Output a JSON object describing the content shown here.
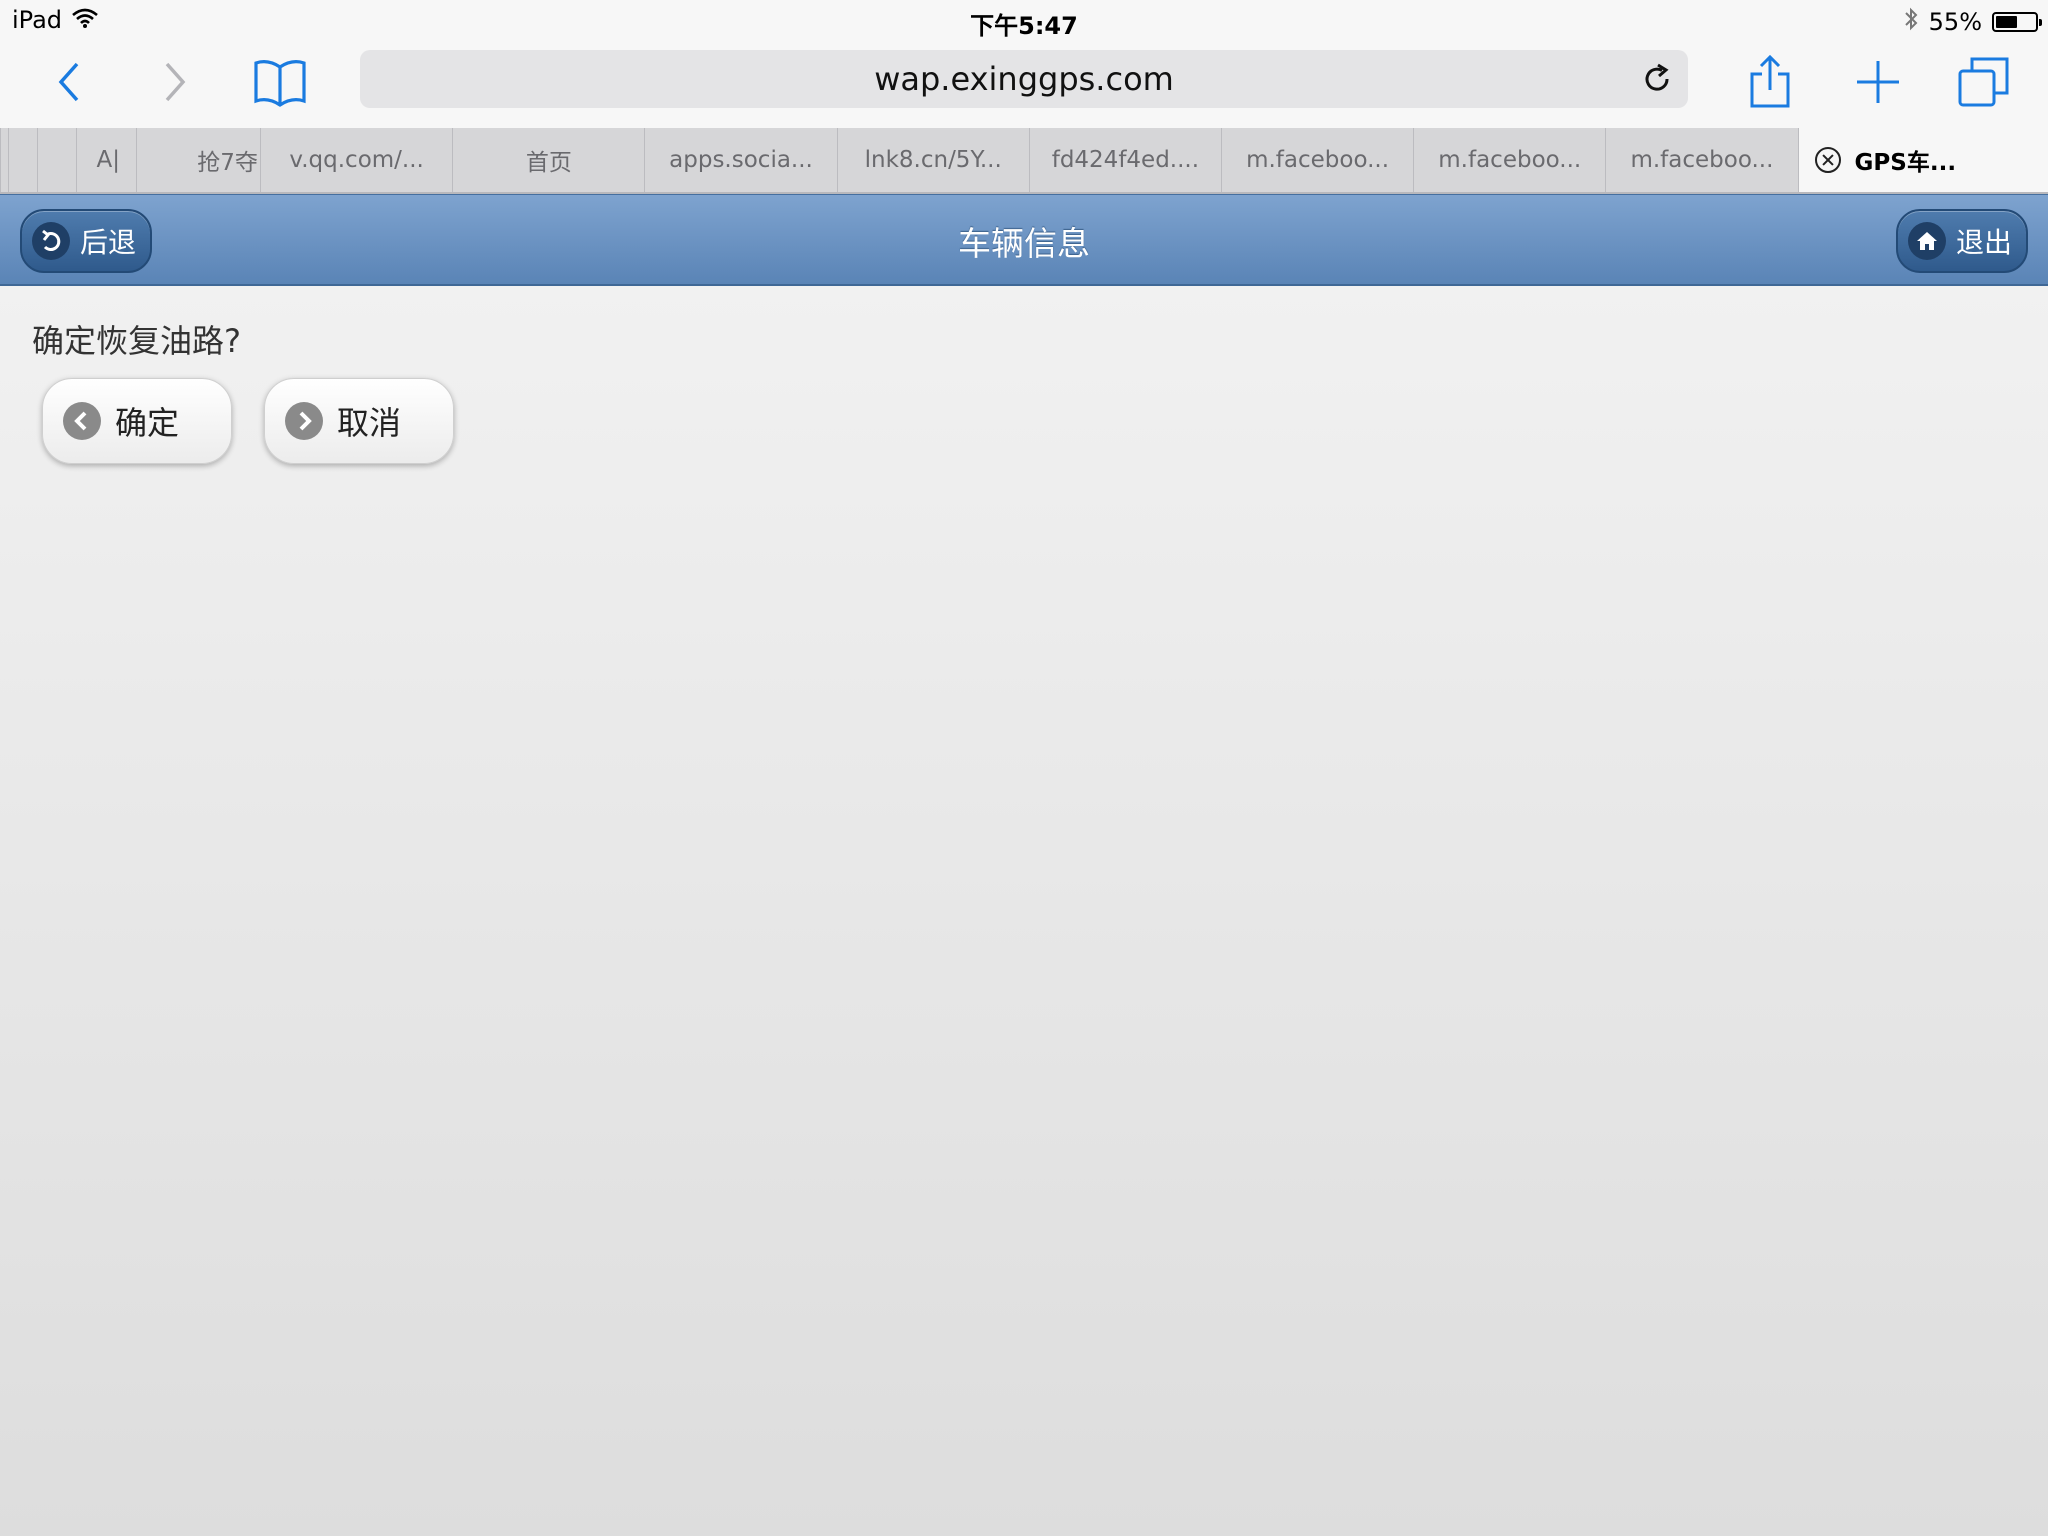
{
  "status_bar": {
    "device": "iPad",
    "time": "下午5:47",
    "battery_level": "55%",
    "battery_fraction": 0.55
  },
  "browser": {
    "url": "wap.exinggps.com",
    "icons": [
      "chevron-left-icon",
      "chevron-right-icon",
      "bookmarks-icon",
      "reload-icon",
      "share-icon",
      "plus-icon",
      "tabs-icon"
    ]
  },
  "tabs": [
    {
      "label": ""
    },
    {
      "label": ""
    },
    {
      "label": "A|"
    },
    {
      "label": "抢7夺"
    },
    {
      "label": "v.qq.com/..."
    },
    {
      "label": "首页"
    },
    {
      "label": "apps.socia..."
    },
    {
      "label": "lnk8.cn/5Y..."
    },
    {
      "label": "fd424f4ed...."
    },
    {
      "label": "m.faceboo..."
    },
    {
      "label": "m.faceboo..."
    },
    {
      "label": "m.faceboo..."
    },
    {
      "label": "GPS车..."
    }
  ],
  "header": {
    "title": "车辆信息",
    "back_label": "后退",
    "logout_label": "退出"
  },
  "dialog": {
    "prompt": "确定恢复油路?",
    "confirm_label": "确定",
    "cancel_label": "取消"
  },
  "colors": {
    "header_top": "#7ea3cf",
    "header_bottom": "#5a84b6",
    "ios_blue": "#1a7be0"
  }
}
